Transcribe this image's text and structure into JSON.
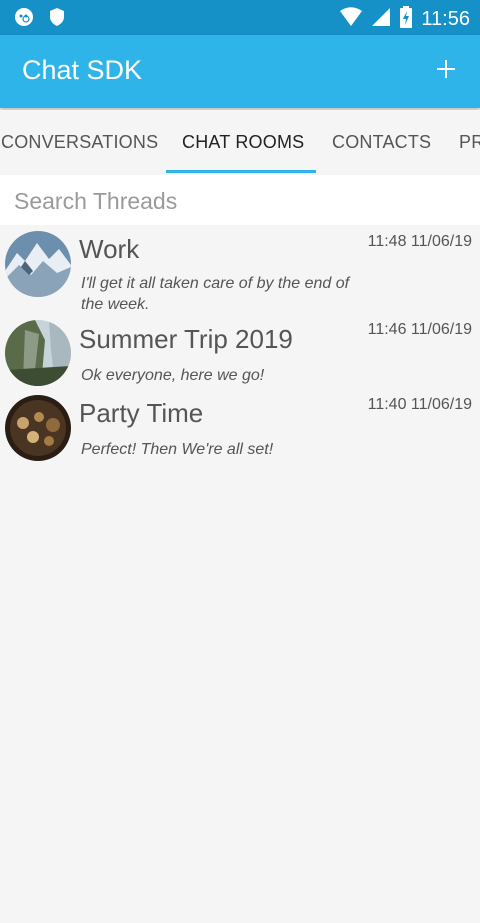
{
  "status_bar": {
    "time": "11:56",
    "left_icons": [
      "wechat-icon",
      "shield-icon"
    ],
    "right_icons": [
      "wifi-icon",
      "cell-signal-icon",
      "battery-charging-icon"
    ]
  },
  "app_bar": {
    "title": "Chat SDK",
    "action_icon": "plus-icon"
  },
  "tabs": [
    {
      "label": "CONVERSATIONS",
      "active": false
    },
    {
      "label": "CHAT ROOMS",
      "active": true
    },
    {
      "label": "CONTACTS",
      "active": false
    },
    {
      "label": "PR",
      "active": false
    }
  ],
  "search": {
    "placeholder": "Search Threads",
    "value": ""
  },
  "threads": [
    {
      "name": "Work",
      "time": "11:48 11/06/19",
      "last_message": "I'll get it all taken care of by the end of the week.",
      "avatar": "snowy-mountain"
    },
    {
      "name": "Summer Trip 2019",
      "time": "11:46 11/06/19",
      "last_message": "Ok everyone, here we go!",
      "avatar": "cliff-waterfall"
    },
    {
      "name": "Party Time",
      "time": "11:40 11/06/19",
      "last_message": "Perfect! Then We're all set!",
      "avatar": "food-platter"
    }
  ],
  "colors": {
    "status_bar": "#1591c8",
    "app_bar": "#2eb4e8",
    "accent": "#2eb4e8"
  }
}
